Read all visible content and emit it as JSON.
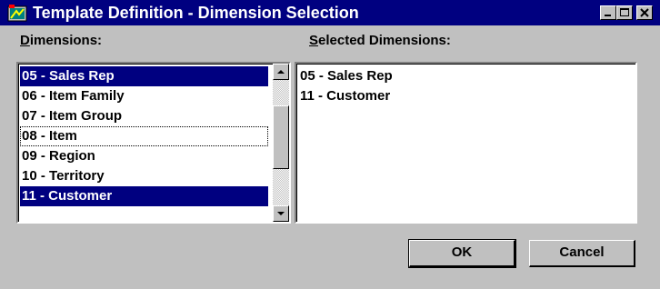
{
  "window": {
    "title": "Template Definition - Dimension Selection"
  },
  "dimensions": {
    "label_prefix": "D",
    "label_rest": "imensions:",
    "items": [
      {
        "label": "05 - Sales Rep",
        "selected": true
      },
      {
        "label": "06 - Item Family",
        "selected": false
      },
      {
        "label": "07 - Item Group",
        "selected": false
      },
      {
        "label": "08 - Item",
        "selected": false,
        "focused": true
      },
      {
        "label": "09 - Region",
        "selected": false
      },
      {
        "label": "10 - Territory",
        "selected": false
      },
      {
        "label": "11 - Customer",
        "selected": true
      }
    ]
  },
  "selected_dimensions": {
    "label_prefix": "S",
    "label_rest": "elected Dimensions:",
    "items": [
      {
        "label": "05 - Sales Rep"
      },
      {
        "label": "11 - Customer"
      }
    ]
  },
  "buttons": {
    "ok": "OK",
    "cancel": "Cancel"
  },
  "icons": {
    "app": "template-app-icon",
    "minimize": "minimize-icon",
    "maximize": "maximize-icon",
    "close": "close-icon",
    "scroll_up": "arrow-up-icon",
    "scroll_down": "arrow-down-icon"
  },
  "colors": {
    "titlebar": "#000080",
    "selection": "#000080",
    "face": "#c0c0c0"
  }
}
